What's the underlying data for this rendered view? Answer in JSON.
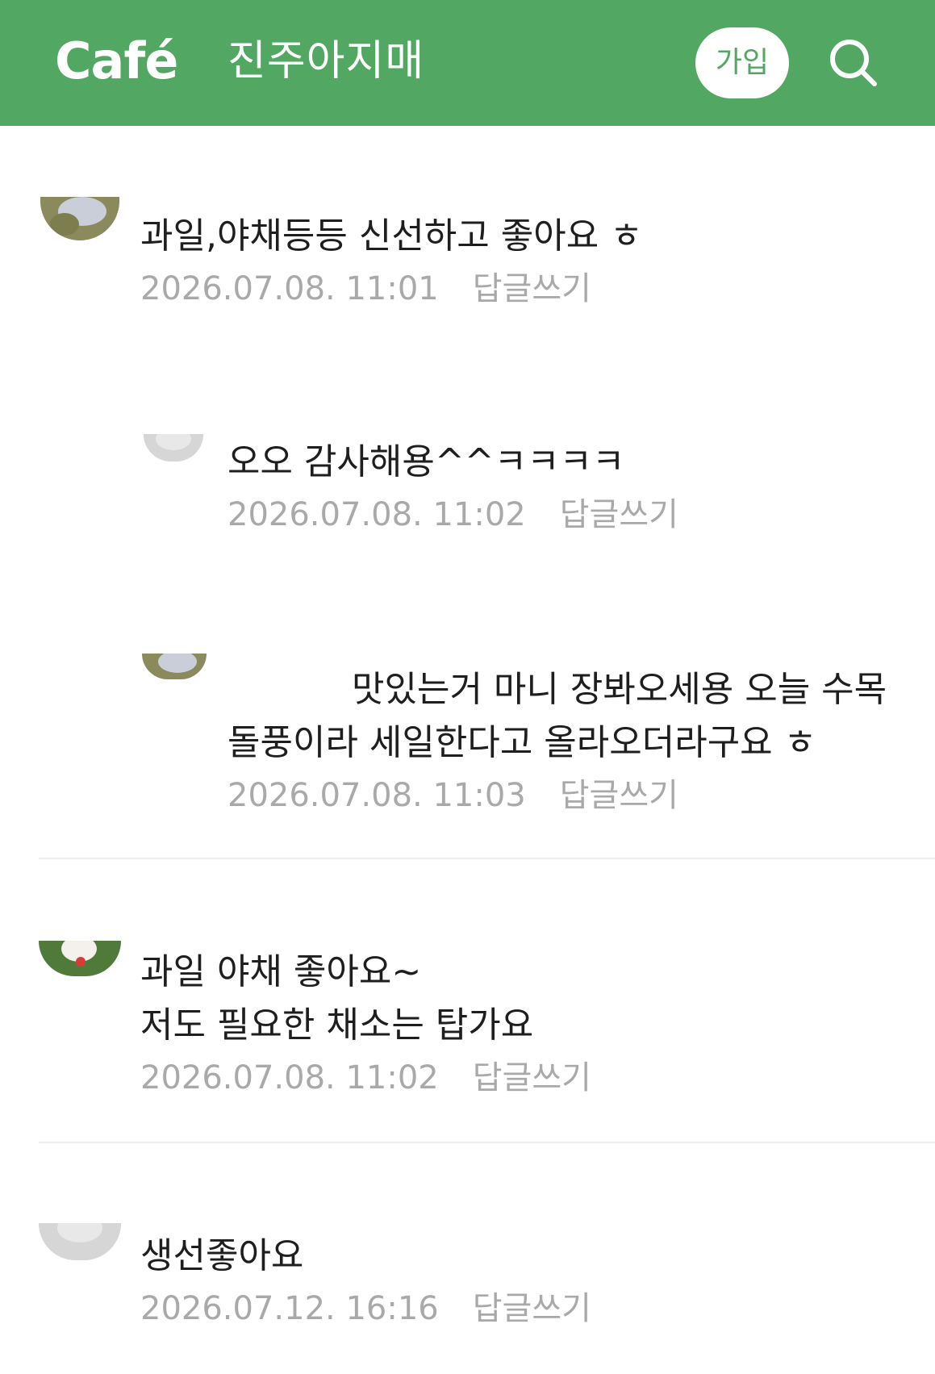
{
  "header": {
    "logo": "Café",
    "cafe_name": "진주아지매",
    "join_label": "가입",
    "background_color": "#52a862"
  },
  "comments": [
    {
      "text": "과일,야채등등 신선하고 좋아요 ㅎ",
      "time": "2026.07.08. 11:01",
      "reply_label": "답글쓰기",
      "is_reply": false
    },
    {
      "text": "오오 감사해용^^ㅋㅋㅋㅋ",
      "time": "2026.07.08. 11:02",
      "reply_label": "답글쓰기",
      "is_reply": true
    },
    {
      "text": "맛있는거 마니 장봐오세용 오늘 수목 돌풍이라 세일한다고 올라오더라구요 ㅎ",
      "time": "2026.07.08. 11:03",
      "reply_label": "답글쓰기",
      "is_reply": true
    },
    {
      "text": "과일 야채 좋아요~\n저도 필요한 채소는 탑가요",
      "time": "2026.07.08. 11:02",
      "reply_label": "답글쓰기",
      "is_reply": false
    },
    {
      "text": "생선좋아요",
      "time": "2026.07.12. 16:16",
      "reply_label": "답글쓰기",
      "is_reply": false
    }
  ]
}
